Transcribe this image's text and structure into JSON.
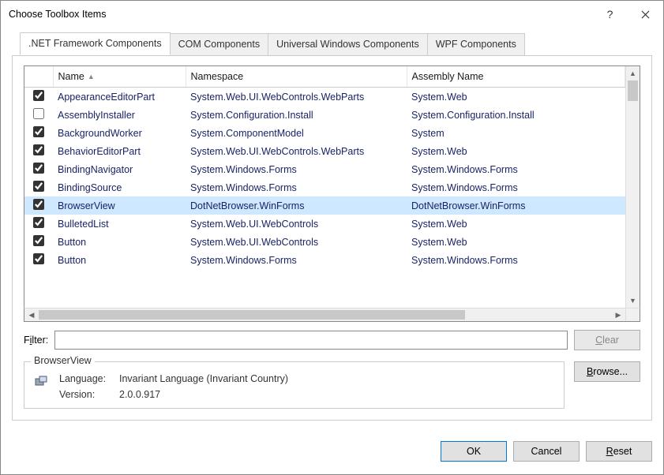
{
  "title": "Choose Toolbox Items",
  "tabs": [
    ".NET Framework Components",
    "COM Components",
    "Universal Windows Components",
    "WPF Components"
  ],
  "columns": {
    "name": "Name",
    "namespace": "Namespace",
    "assembly": "Assembly Name"
  },
  "rows": [
    {
      "checked": true,
      "name": "AppearanceEditorPart",
      "ns": "System.Web.UI.WebControls.WebParts",
      "asm": "System.Web",
      "sel": false
    },
    {
      "checked": false,
      "name": "AssemblyInstaller",
      "ns": "System.Configuration.Install",
      "asm": "System.Configuration.Install",
      "sel": false
    },
    {
      "checked": true,
      "name": "BackgroundWorker",
      "ns": "System.ComponentModel",
      "asm": "System",
      "sel": false
    },
    {
      "checked": true,
      "name": "BehaviorEditorPart",
      "ns": "System.Web.UI.WebControls.WebParts",
      "asm": "System.Web",
      "sel": false
    },
    {
      "checked": true,
      "name": "BindingNavigator",
      "ns": "System.Windows.Forms",
      "asm": "System.Windows.Forms",
      "sel": false
    },
    {
      "checked": true,
      "name": "BindingSource",
      "ns": "System.Windows.Forms",
      "asm": "System.Windows.Forms",
      "sel": false
    },
    {
      "checked": true,
      "name": "BrowserView",
      "ns": "DotNetBrowser.WinForms",
      "asm": "DotNetBrowser.WinForms",
      "sel": true
    },
    {
      "checked": true,
      "name": "BulletedList",
      "ns": "System.Web.UI.WebControls",
      "asm": "System.Web",
      "sel": false
    },
    {
      "checked": true,
      "name": "Button",
      "ns": "System.Web.UI.WebControls",
      "asm": "System.Web",
      "sel": false
    },
    {
      "checked": true,
      "name": "Button",
      "ns": "System.Windows.Forms",
      "asm": "System.Windows.Forms",
      "sel": false
    }
  ],
  "filter": {
    "label_pre": "F",
    "label_ul": "i",
    "label_post": "lter:",
    "value": ""
  },
  "buttons": {
    "clear_pre": "",
    "clear_ul": "C",
    "clear_post": "lear",
    "browse_pre": "",
    "browse_ul": "B",
    "browse_post": "rowse...",
    "ok": "OK",
    "cancel": "Cancel",
    "reset_pre": "",
    "reset_ul": "R",
    "reset_post": "eset"
  },
  "details": {
    "title": "BrowserView",
    "language_label": "Language:",
    "language_value": "Invariant Language (Invariant Country)",
    "version_label": "Version:",
    "version_value": "2.0.0.917"
  }
}
